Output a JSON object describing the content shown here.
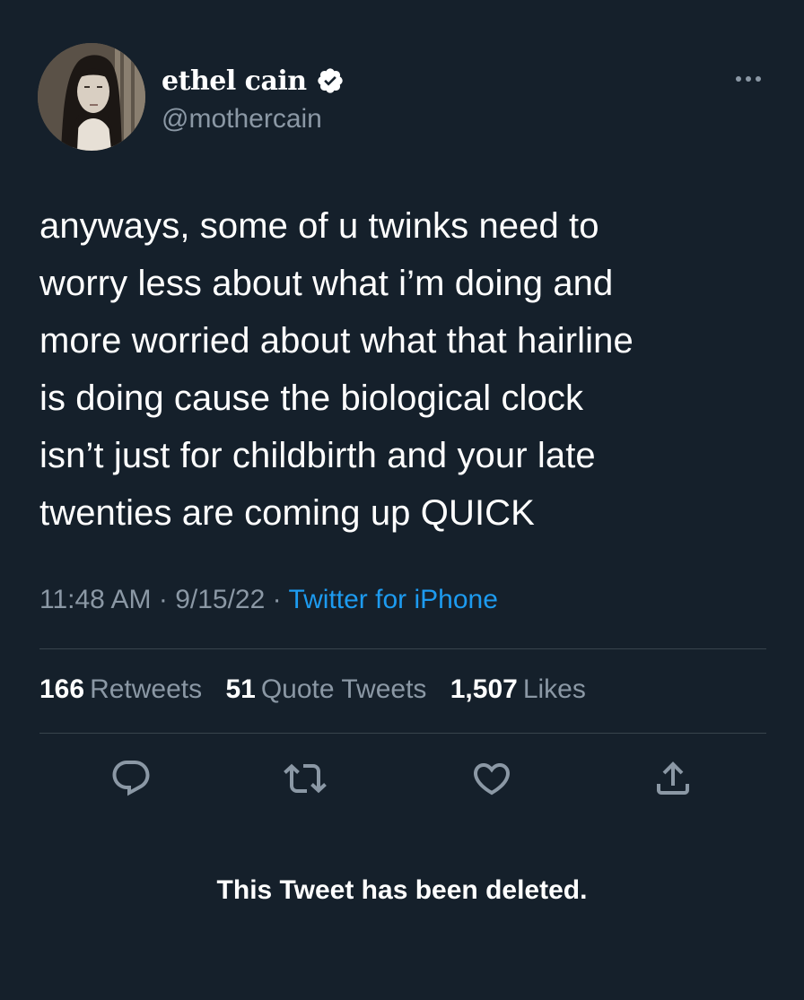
{
  "author": {
    "display_name": "ethel cain",
    "handle": "@mothercain",
    "verified": true,
    "avatar": "avatar-photo"
  },
  "tweet": {
    "lines": [
      "anyways, some of u twinks need to",
      "worry less about what i’m doing and",
      "more worried about what that hairline",
      "is doing cause the biological clock",
      "isn’t just for childbirth and your late",
      "twenties are coming up QUICK"
    ],
    "time": "11:48 AM",
    "date": "9/15/22",
    "separator": "·",
    "source": "Twitter for iPhone"
  },
  "stats": {
    "retweets_count": "166",
    "retweets_label": "Retweets",
    "quotes_count": "51",
    "quotes_label": "Quote Tweets",
    "likes_count": "1,507",
    "likes_label": "Likes"
  },
  "actions": {
    "reply_icon": "reply-icon",
    "retweet_icon": "retweet-icon",
    "like_icon": "heart-icon",
    "share_icon": "share-icon"
  },
  "notice": "This Tweet has been deleted.",
  "colors": {
    "background": "#15202b",
    "text": "#ffffff",
    "secondary": "#8b98a5",
    "link": "#1d9bf0",
    "divider": "#38444d"
  }
}
